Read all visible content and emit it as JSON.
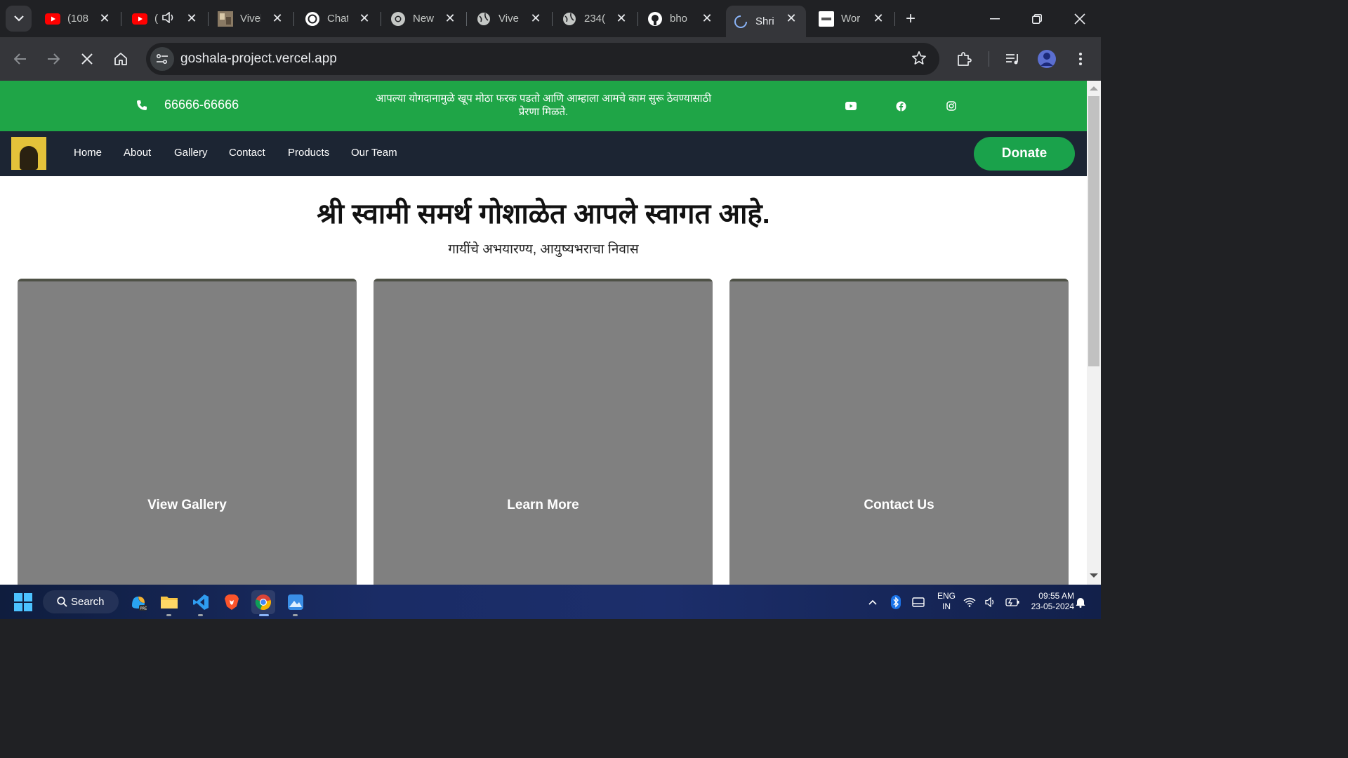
{
  "browser": {
    "tabs": [
      {
        "title": "(108",
        "icon": "youtube-icon",
        "active": false
      },
      {
        "title": "(",
        "icon": "youtube-icon",
        "active": false,
        "audio": true
      },
      {
        "title": "Vivel",
        "icon": "image-favicon",
        "active": false
      },
      {
        "title": "Chat",
        "icon": "chatgpt-icon",
        "active": false
      },
      {
        "title": "New",
        "icon": "chrome-icon",
        "active": false
      },
      {
        "title": "Vive",
        "icon": "globe-icon",
        "active": false
      },
      {
        "title": "234(",
        "icon": "globe-icon",
        "active": false
      },
      {
        "title": "bho",
        "icon": "github-icon",
        "active": false
      },
      {
        "title": "Shri",
        "icon": "loading-spinner-icon",
        "active": true
      },
      {
        "title": "Wor",
        "icon": "site-favicon",
        "active": false
      }
    ],
    "url": "goshala-project.vercel.app"
  },
  "page": {
    "topbar": {
      "phone": "66666-66666",
      "motto_line1": "आपल्या योगदानामुळे खूप मोठा फरक पडतो आणि आम्हाला आमचे काम सुरू ठेवण्यासाठी",
      "motto_line2": "प्रेरणा मिळते.",
      "accent": "#1fa547"
    },
    "nav": {
      "links": [
        "Home",
        "About",
        "Gallery",
        "Contact",
        "Products",
        "Our Team"
      ],
      "donate_label": "Donate"
    },
    "hero": {
      "title": "श्री स्वामी समर्थ गोशाळेत आपले स्वागत आहे.",
      "subtitle": "गायींचे अभयारण्य, आयुष्यभराचा निवास"
    },
    "cards": [
      {
        "label": "View Gallery"
      },
      {
        "label": "Learn More"
      },
      {
        "label": "Contact Us"
      }
    ]
  },
  "taskbar": {
    "search_label": "Search",
    "language_line1": "ENG",
    "language_line2": "IN",
    "time": "09:55 AM",
    "date": "23-05-2024"
  }
}
